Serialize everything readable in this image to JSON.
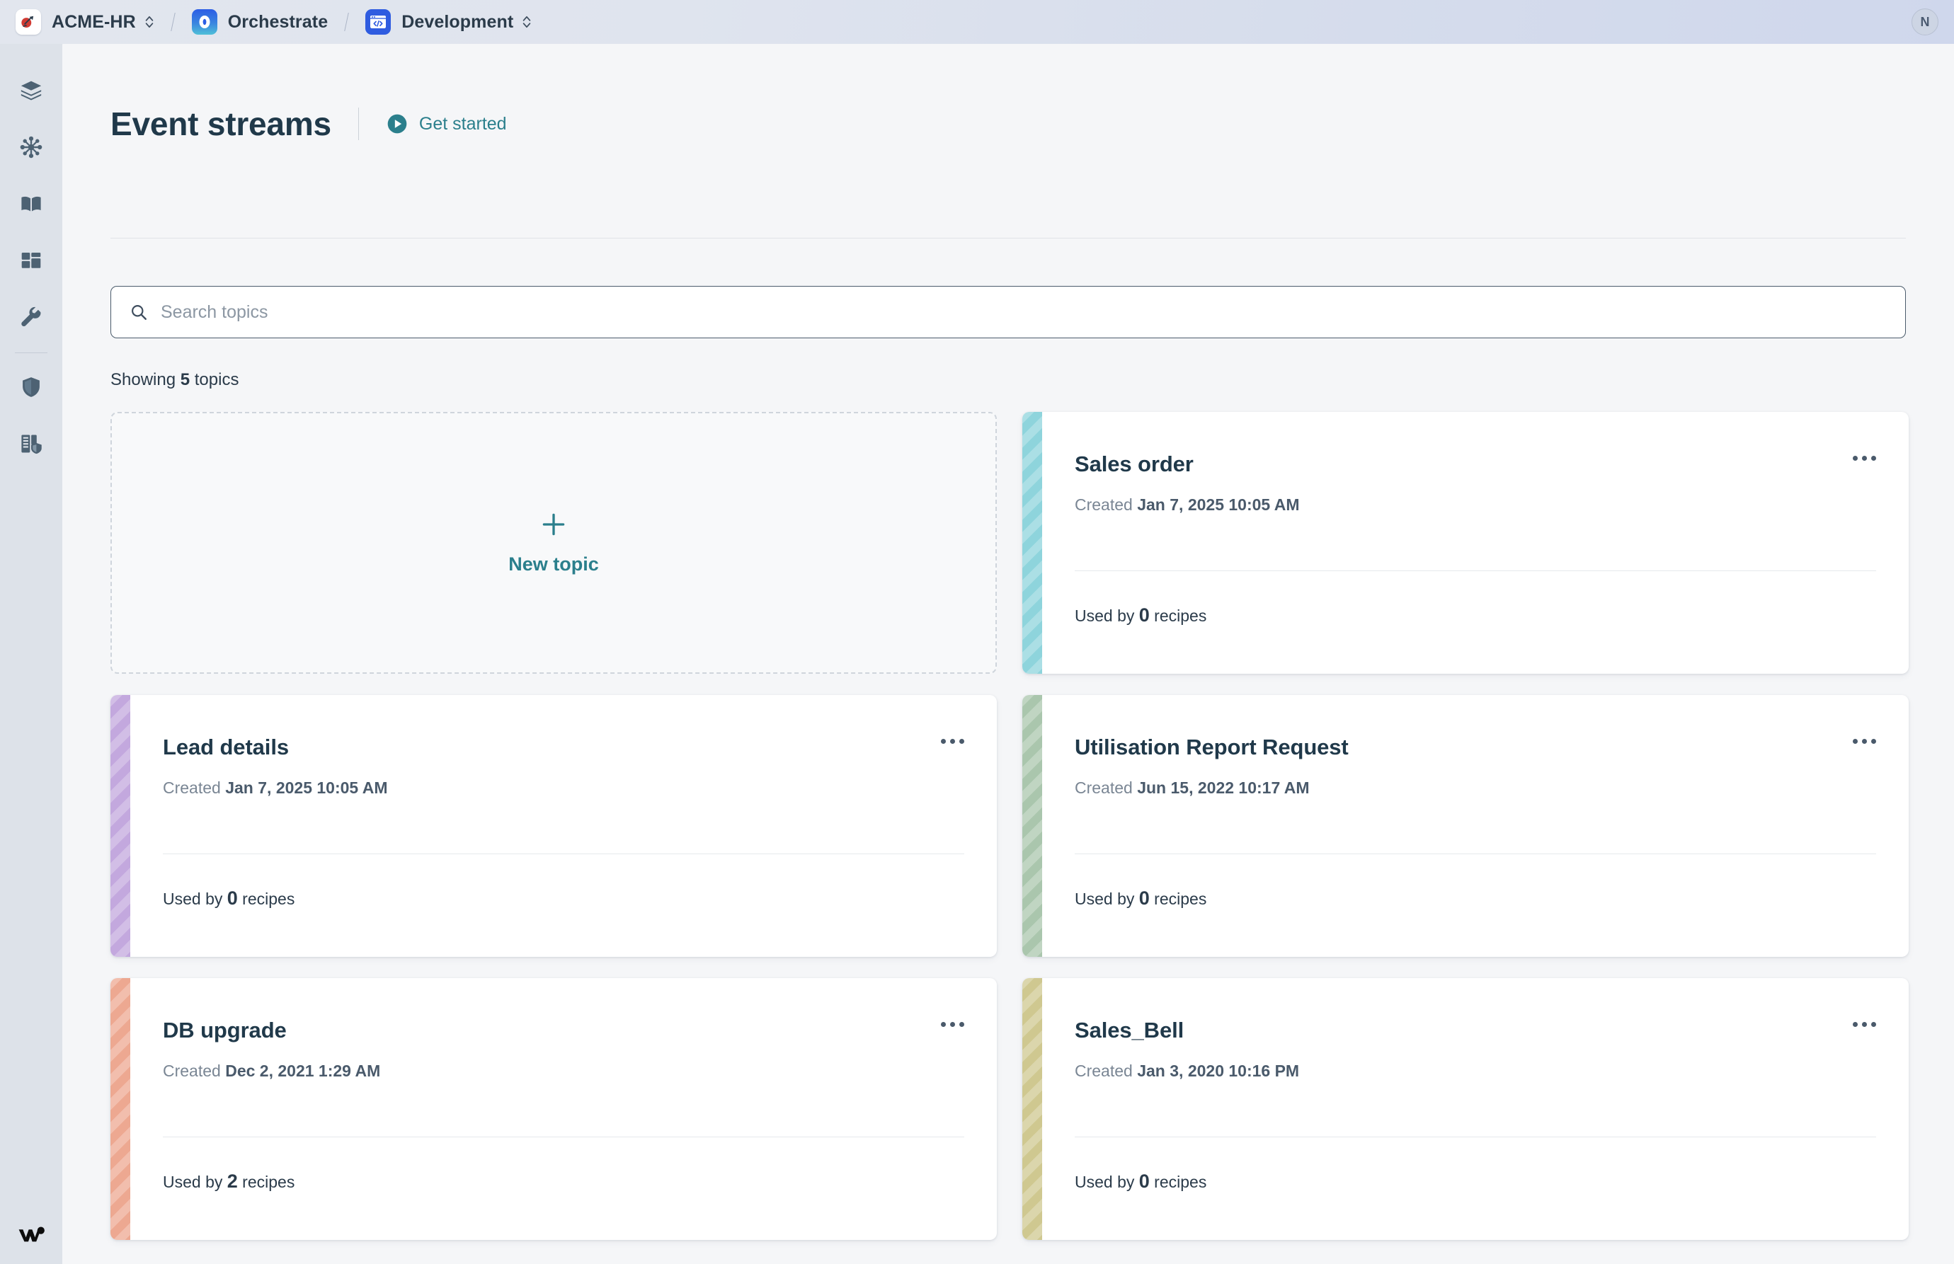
{
  "topbar": {
    "breadcrumbs": [
      {
        "label": "ACME-HR",
        "icon": "rocket-icon",
        "has_caret": true
      },
      {
        "label": "Orchestrate",
        "icon": "orchestrate-icon",
        "has_caret": false
      },
      {
        "label": "Development",
        "icon": "code-window-icon",
        "has_caret": true
      }
    ],
    "avatar_initial": "N"
  },
  "rail": {
    "items": [
      {
        "name": "layers-icon"
      },
      {
        "name": "hub-network-icon"
      },
      {
        "name": "book-icon"
      },
      {
        "name": "dashboard-grid-icon"
      },
      {
        "name": "wrench-icon"
      }
    ],
    "items_lower": [
      {
        "name": "shield-icon"
      },
      {
        "name": "server-shield-icon"
      }
    ],
    "logo": "workato-logo"
  },
  "header": {
    "title": "Event streams",
    "get_started_label": "Get started",
    "play_icon": "play-circle-icon"
  },
  "search": {
    "placeholder": "Search topics",
    "value": "",
    "icon": "search-icon"
  },
  "summary": {
    "prefix": "Showing ",
    "count": "5",
    "suffix": " topics"
  },
  "new_topic": {
    "label": "New topic",
    "icon": "plus-icon"
  },
  "labels": {
    "created_prefix": "Created ",
    "used_prefix": "Used by ",
    "used_suffix": " recipes",
    "menu_icon": "more-options-icon"
  },
  "colors": {
    "accent_teal": "#2b7f8c",
    "title_navy": "#20394a",
    "panel_bg": "#f5f6f8",
    "rail_bg": "#dde2e9"
  },
  "topics": [
    {
      "name": "Sales order",
      "created": "Jan 7, 2025 10:05 AM",
      "used_by": "0",
      "stripe_color": "#8ed4dc"
    },
    {
      "name": "Lead details",
      "created": "Jan 7, 2025 10:05 AM",
      "used_by": "0",
      "stripe_color": "#c3a8de"
    },
    {
      "name": "Utilisation Report Request",
      "created": "Jun 15, 2022 10:17 AM",
      "used_by": "0",
      "stripe_color": "#aac6ad"
    },
    {
      "name": "DB upgrade",
      "created": "Dec 2, 2021 1:29 AM",
      "used_by": "2",
      "stripe_color": "#eda891"
    },
    {
      "name": "Sales_Bell",
      "created": "Jan 3, 2020 10:16 PM",
      "used_by": "0",
      "stripe_color": "#cfc890"
    }
  ]
}
